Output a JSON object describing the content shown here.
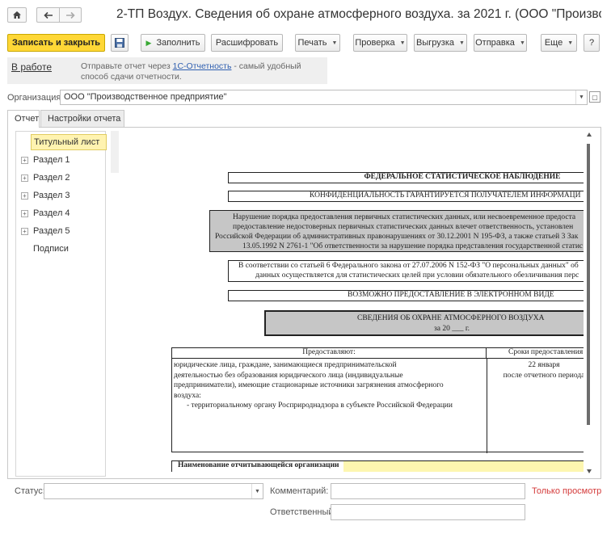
{
  "window": {
    "title": "2-ТП Воздух. Сведения об охране атмосферного воздуха. за 2021 г. (ООО \"Производс...",
    "home_icon": "home-icon",
    "back_icon": "arrow-left-icon",
    "forward_icon": "arrow-right-icon"
  },
  "toolbar": {
    "save_close": "Записать и закрыть",
    "save_icon": "floppy-disk-icon",
    "fill": "Заполнить",
    "decode": "Расшифровать",
    "print": "Печать",
    "check": "Проверка",
    "export": "Выгрузка",
    "send": "Отправка",
    "more": "Еще",
    "help": "?"
  },
  "banner": {
    "status": "В работе",
    "message_prefix": "Отправьте отчет через ",
    "message_link": "1С-Отчетность",
    "message_suffix": " - самый удобный способ сдачи отчетности."
  },
  "organization": {
    "label": "Организация:",
    "value": "ООО \"Производственное предприятие\""
  },
  "tabs": [
    {
      "label": "Отчет",
      "active": true
    },
    {
      "label": "Настройки отчета",
      "active": false
    }
  ],
  "sidebar": {
    "items": [
      {
        "label": "Титульный лист",
        "expandable": false,
        "selected": true
      },
      {
        "label": "Раздел 1",
        "expandable": true,
        "selected": false
      },
      {
        "label": "Раздел 2",
        "expandable": true,
        "selected": false
      },
      {
        "label": "Раздел 3",
        "expandable": true,
        "selected": false
      },
      {
        "label": "Раздел 4",
        "expandable": true,
        "selected": false
      },
      {
        "label": "Раздел 5",
        "expandable": true,
        "selected": false
      },
      {
        "label": "Подписи",
        "expandable": false,
        "selected": false
      }
    ]
  },
  "document": {
    "header1": "ФЕДЕРАЛЬНОЕ СТАТИСТИЧЕСКОЕ НАБЛЮДЕНИЕ",
    "header2": "КОНФИДЕНЦИАЛЬНОСТЬ ГАРАНТИРУЕТСЯ ПОЛУЧАТЕЛЕМ ИНФОРМАЦИ",
    "warning_lines": [
      "Нарушение порядка предоставления первичных статистических данных, или несвоевременное предоста",
      "предоставление недостоверных первичных статистических данных влечет ответственность, установлен",
      "Российской Федерации об административных правонарушениях от 30.12.2001 N 195-ФЗ, а также статьей 3 Зак",
      "13.05.1992 N 2761-1 \"Об ответственности за нарушение порядка представления государственной статис"
    ],
    "personal_data_lines": [
      "В соответствии со статьей 6 Федерального закона от 27.07.2006 N 152-ФЗ \"О персональных данных\" об",
      "данных осуществляется для статистических целей при условии обязательного обезличивания перс"
    ],
    "electronic": "ВОЗМОЖНО ПРЕДОСТАВЛЕНИЕ В ЭЛЕКТРОННОМ ВИДЕ",
    "form_title": "СВЕДЕНИЯ ОБ ОХРАНЕ АТМОСФЕРНОГО ВОЗДУХА",
    "form_year": "за 20 ___  г.",
    "table": {
      "col1_header": "Предоставляют:",
      "col2_header": "Сроки предоставления",
      "col1_lines": [
        "юридические лица, граждане, занимающиеся предпринимательской",
        "деятельностью без образования юридического лица (индивидуальные",
        "предприниматели), имеющие стационарные источники загрязнения атмосферного",
        "воздуха:"
      ],
      "col1_item": "- территориальному органу Росприроднадзора в субъекте Российской Федерации",
      "col2_lines": [
        "22 января",
        "после отчетного периода"
      ]
    },
    "org_name_label": "Наименование отчитывающейся организации"
  },
  "footer": {
    "status_label": "Статус:",
    "status_value": "",
    "comment_label": "Комментарий:",
    "comment_value": "",
    "responsible_label": "Ответственный:",
    "responsible_value": "",
    "readonly": "Только просмотр"
  }
}
